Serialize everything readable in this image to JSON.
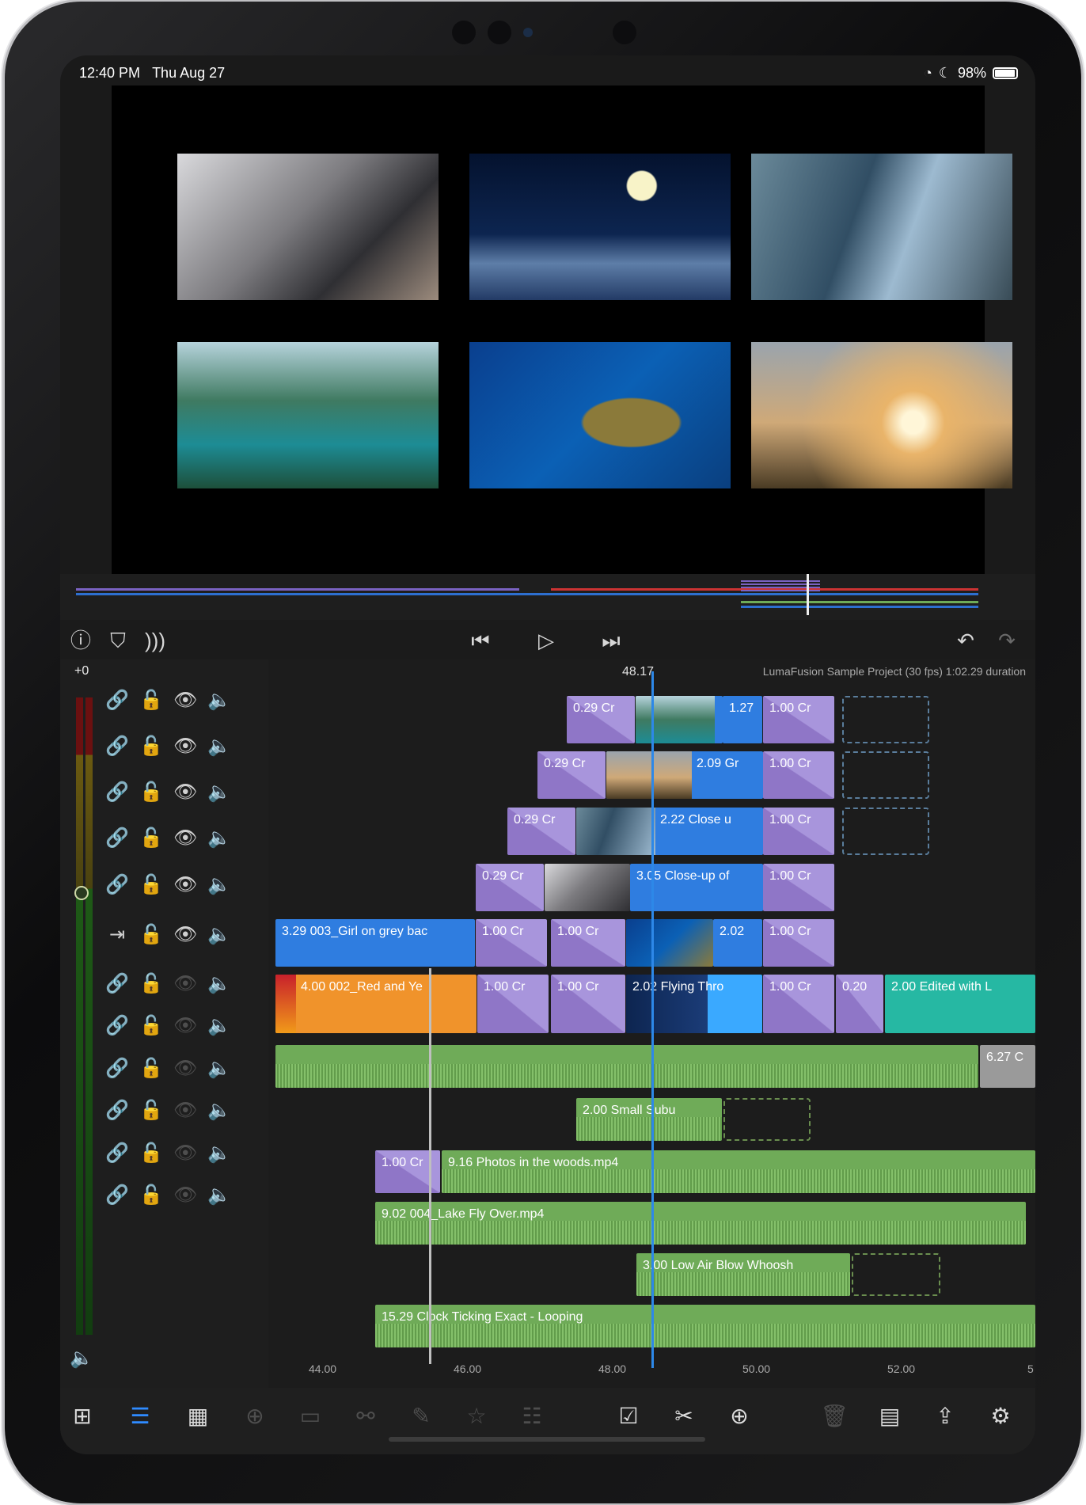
{
  "status_bar": {
    "time": "12:40 PM",
    "date": "Thu Aug 27",
    "battery": "98%",
    "wifi_icon": "wifi-icon",
    "moon_icon": "moon-icon"
  },
  "viewer": {
    "thumbnails": [
      "laptop-typing",
      "moon-clouds",
      "glasses-reflection",
      "mountain-lake",
      "sea-turtle",
      "people-running"
    ]
  },
  "transport": {
    "info_icon": "info-icon",
    "marker_icon": "add-marker-icon",
    "audio_icon": "audio-add-icon",
    "prev_icon": "skip-back-icon",
    "play_icon": "play-icon",
    "next_icon": "skip-forward-icon",
    "undo_icon": "undo-icon",
    "redo_icon": "redo-icon"
  },
  "timeline": {
    "gain_label": "+0",
    "playhead_time": "48.17",
    "project_info": "LumaFusion Sample Project (30 fps)  1:02.29 duration",
    "ruler": [
      "44.00",
      "46.00",
      "48.00",
      "50.00",
      "52.00",
      "5"
    ],
    "clips": {
      "r1": [
        "0.29  Cr",
        "1.27",
        "1.00  Cr"
      ],
      "r2": [
        "0.29  Cr",
        "2.09  Gr",
        "1.00  Cr"
      ],
      "r3": [
        "0.29  Cr",
        "2.22  Close u",
        "1.00  Cr"
      ],
      "r4": [
        "0.29  Cr",
        "3.05  Close-up of",
        "1.00  Cr"
      ],
      "r5": [
        "3.29  003_Girl on grey bac",
        "1.00  Cr",
        "1.00  Cr",
        "2.02",
        "1.00  Cr"
      ],
      "r6": [
        "4.00  002_Red and Ye",
        "1.00  Cr",
        "1.00  Cr",
        "2.02  Flying Thro",
        "1.00  Cr",
        "0.20",
        "2.00  Edited with L"
      ],
      "a1": [
        "6.27  C"
      ],
      "a2": [
        "2.00  Small Subu"
      ],
      "a3": [
        "1.00  Cr",
        "9.16  Photos in the woods.mp4"
      ],
      "a4": [
        "9.02  004_Lake Fly Over.mp4"
      ],
      "a5": [
        "3.00  Low Air Blow Whoosh"
      ],
      "a6": [
        "15.29  Clock Ticking Exact - Looping"
      ]
    }
  },
  "toolbar": {
    "icons": [
      "add-media-icon",
      "library-icon",
      "layout-icon",
      "add-track-icon",
      "audio-track-icon",
      "link-icon",
      "edit-icon",
      "favorite-icon",
      "paste-icon",
      "select-icon",
      "cut-icon",
      "add-icon",
      "delete-icon",
      "layout-panel-icon",
      "share-icon",
      "settings-icon"
    ]
  }
}
